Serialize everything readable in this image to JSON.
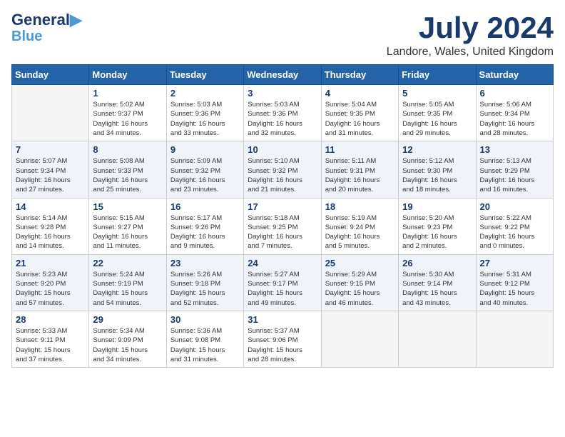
{
  "header": {
    "logo_line1": "General",
    "logo_line2": "Blue",
    "month": "July 2024",
    "location": "Landore, Wales, United Kingdom"
  },
  "days_of_week": [
    "Sunday",
    "Monday",
    "Tuesday",
    "Wednesday",
    "Thursday",
    "Friday",
    "Saturday"
  ],
  "weeks": [
    [
      {
        "day": "",
        "info": ""
      },
      {
        "day": "1",
        "info": "Sunrise: 5:02 AM\nSunset: 9:37 PM\nDaylight: 16 hours\nand 34 minutes."
      },
      {
        "day": "2",
        "info": "Sunrise: 5:03 AM\nSunset: 9:36 PM\nDaylight: 16 hours\nand 33 minutes."
      },
      {
        "day": "3",
        "info": "Sunrise: 5:03 AM\nSunset: 9:36 PM\nDaylight: 16 hours\nand 32 minutes."
      },
      {
        "day": "4",
        "info": "Sunrise: 5:04 AM\nSunset: 9:35 PM\nDaylight: 16 hours\nand 31 minutes."
      },
      {
        "day": "5",
        "info": "Sunrise: 5:05 AM\nSunset: 9:35 PM\nDaylight: 16 hours\nand 29 minutes."
      },
      {
        "day": "6",
        "info": "Sunrise: 5:06 AM\nSunset: 9:34 PM\nDaylight: 16 hours\nand 28 minutes."
      }
    ],
    [
      {
        "day": "7",
        "info": "Sunrise: 5:07 AM\nSunset: 9:34 PM\nDaylight: 16 hours\nand 27 minutes."
      },
      {
        "day": "8",
        "info": "Sunrise: 5:08 AM\nSunset: 9:33 PM\nDaylight: 16 hours\nand 25 minutes."
      },
      {
        "day": "9",
        "info": "Sunrise: 5:09 AM\nSunset: 9:32 PM\nDaylight: 16 hours\nand 23 minutes."
      },
      {
        "day": "10",
        "info": "Sunrise: 5:10 AM\nSunset: 9:32 PM\nDaylight: 16 hours\nand 21 minutes."
      },
      {
        "day": "11",
        "info": "Sunrise: 5:11 AM\nSunset: 9:31 PM\nDaylight: 16 hours\nand 20 minutes."
      },
      {
        "day": "12",
        "info": "Sunrise: 5:12 AM\nSunset: 9:30 PM\nDaylight: 16 hours\nand 18 minutes."
      },
      {
        "day": "13",
        "info": "Sunrise: 5:13 AM\nSunset: 9:29 PM\nDaylight: 16 hours\nand 16 minutes."
      }
    ],
    [
      {
        "day": "14",
        "info": "Sunrise: 5:14 AM\nSunset: 9:28 PM\nDaylight: 16 hours\nand 14 minutes."
      },
      {
        "day": "15",
        "info": "Sunrise: 5:15 AM\nSunset: 9:27 PM\nDaylight: 16 hours\nand 11 minutes."
      },
      {
        "day": "16",
        "info": "Sunrise: 5:17 AM\nSunset: 9:26 PM\nDaylight: 16 hours\nand 9 minutes."
      },
      {
        "day": "17",
        "info": "Sunrise: 5:18 AM\nSunset: 9:25 PM\nDaylight: 16 hours\nand 7 minutes."
      },
      {
        "day": "18",
        "info": "Sunrise: 5:19 AM\nSunset: 9:24 PM\nDaylight: 16 hours\nand 5 minutes."
      },
      {
        "day": "19",
        "info": "Sunrise: 5:20 AM\nSunset: 9:23 PM\nDaylight: 16 hours\nand 2 minutes."
      },
      {
        "day": "20",
        "info": "Sunrise: 5:22 AM\nSunset: 9:22 PM\nDaylight: 16 hours\nand 0 minutes."
      }
    ],
    [
      {
        "day": "21",
        "info": "Sunrise: 5:23 AM\nSunset: 9:20 PM\nDaylight: 15 hours\nand 57 minutes."
      },
      {
        "day": "22",
        "info": "Sunrise: 5:24 AM\nSunset: 9:19 PM\nDaylight: 15 hours\nand 54 minutes."
      },
      {
        "day": "23",
        "info": "Sunrise: 5:26 AM\nSunset: 9:18 PM\nDaylight: 15 hours\nand 52 minutes."
      },
      {
        "day": "24",
        "info": "Sunrise: 5:27 AM\nSunset: 9:17 PM\nDaylight: 15 hours\nand 49 minutes."
      },
      {
        "day": "25",
        "info": "Sunrise: 5:29 AM\nSunset: 9:15 PM\nDaylight: 15 hours\nand 46 minutes."
      },
      {
        "day": "26",
        "info": "Sunrise: 5:30 AM\nSunset: 9:14 PM\nDaylight: 15 hours\nand 43 minutes."
      },
      {
        "day": "27",
        "info": "Sunrise: 5:31 AM\nSunset: 9:12 PM\nDaylight: 15 hours\nand 40 minutes."
      }
    ],
    [
      {
        "day": "28",
        "info": "Sunrise: 5:33 AM\nSunset: 9:11 PM\nDaylight: 15 hours\nand 37 minutes."
      },
      {
        "day": "29",
        "info": "Sunrise: 5:34 AM\nSunset: 9:09 PM\nDaylight: 15 hours\nand 34 minutes."
      },
      {
        "day": "30",
        "info": "Sunrise: 5:36 AM\nSunset: 9:08 PM\nDaylight: 15 hours\nand 31 minutes."
      },
      {
        "day": "31",
        "info": "Sunrise: 5:37 AM\nSunset: 9:06 PM\nDaylight: 15 hours\nand 28 minutes."
      },
      {
        "day": "",
        "info": ""
      },
      {
        "day": "",
        "info": ""
      },
      {
        "day": "",
        "info": ""
      }
    ]
  ]
}
